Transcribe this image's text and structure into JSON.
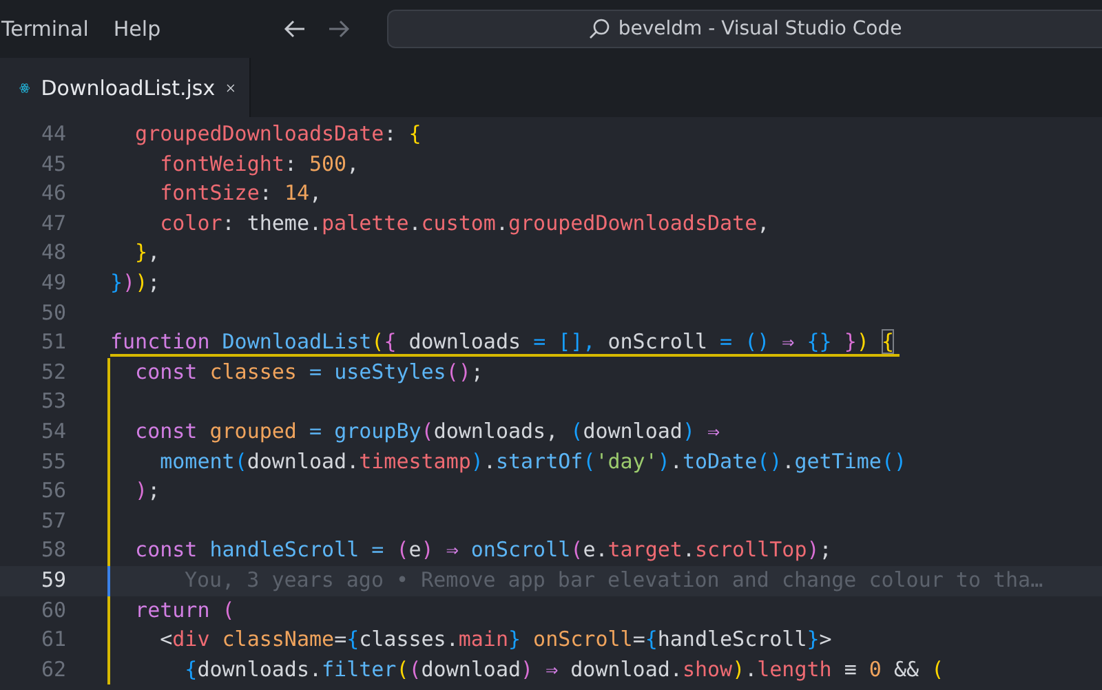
{
  "menu": [
    "Terminal",
    "Help"
  ],
  "command_center": {
    "text": "beveldm - Visual Studio Code"
  },
  "tabs": [
    {
      "label": "DownloadList.jsx",
      "selected": true
    }
  ],
  "editor": {
    "lines": [
      {
        "number": "44",
        "in_scope": false,
        "tokens": [
          {
            "text": "  groupedDownloadsDate",
            "kind": "prop"
          },
          {
            "text": ": ",
            "kind": "plain"
          },
          {
            "text": "{",
            "kind": "b1"
          }
        ]
      },
      {
        "number": "45",
        "in_scope": false,
        "tokens": [
          {
            "text": "    fontWeight",
            "kind": "prop"
          },
          {
            "text": ": ",
            "kind": "plain"
          },
          {
            "text": "500",
            "kind": "num"
          },
          {
            "text": ",",
            "kind": "plain"
          }
        ]
      },
      {
        "number": "46",
        "in_scope": false,
        "tokens": [
          {
            "text": "    fontSize",
            "kind": "prop"
          },
          {
            "text": ": ",
            "kind": "plain"
          },
          {
            "text": "14",
            "kind": "num"
          },
          {
            "text": ",",
            "kind": "plain"
          }
        ]
      },
      {
        "number": "47",
        "in_scope": false,
        "tokens": [
          {
            "text": "    color",
            "kind": "prop"
          },
          {
            "text": ": theme.",
            "kind": "plain"
          },
          {
            "text": "palette",
            "kind": "prop"
          },
          {
            "text": ".",
            "kind": "plain"
          },
          {
            "text": "custom",
            "kind": "prop"
          },
          {
            "text": ".",
            "kind": "plain"
          },
          {
            "text": "groupedDownloadsDate",
            "kind": "prop"
          },
          {
            "text": ",",
            "kind": "plain"
          }
        ]
      },
      {
        "number": "48",
        "in_scope": false,
        "tokens": [
          {
            "text": "  }",
            "kind": "b1"
          },
          {
            "text": ",",
            "kind": "plain"
          }
        ]
      },
      {
        "number": "49",
        "in_scope": false,
        "tokens": [
          {
            "text": "}",
            "kind": "b3"
          },
          {
            "text": ")",
            "kind": "b2"
          },
          {
            "text": ")",
            "kind": "b1"
          },
          {
            "text": ";",
            "kind": "plain"
          }
        ]
      },
      {
        "number": "50",
        "in_scope": false
      },
      {
        "number": "51",
        "in_scope": false,
        "scope_open": true,
        "tokens": [
          {
            "text": "function ",
            "kind": "kw"
          },
          {
            "text": "DownloadList",
            "kind": "fn"
          },
          {
            "text": "(",
            "kind": "b1"
          },
          {
            "text": "{",
            "kind": "b2"
          },
          {
            "text": " downloads ",
            "kind": "plain"
          },
          {
            "text": "= [], ",
            "kind": "b3"
          },
          {
            "text": "onScroll ",
            "kind": "plain"
          },
          {
            "text": "= ()",
            "kind": "b3"
          },
          {
            "text": " ⇒ ",
            "kind": "kw"
          },
          {
            "text": "{}",
            "kind": "b3"
          },
          {
            "text": " }",
            "kind": "b2"
          },
          {
            "text": ") ",
            "kind": "b1"
          },
          {
            "text": "{",
            "kind": "match"
          }
        ]
      },
      {
        "number": "52",
        "in_scope": true,
        "tokens": [
          {
            "text": "  const",
            "kind": "kw"
          },
          {
            "text": " classes",
            "kind": "var"
          },
          {
            "text": " = ",
            "kind": "op"
          },
          {
            "text": "useStyles",
            "kind": "fn"
          },
          {
            "text": "()",
            "kind": "b2"
          },
          {
            "text": ";",
            "kind": "plain"
          }
        ]
      },
      {
        "number": "53",
        "in_scope": true
      },
      {
        "number": "54",
        "in_scope": true,
        "tokens": [
          {
            "text": "  const",
            "kind": "kw"
          },
          {
            "text": " grouped",
            "kind": "var"
          },
          {
            "text": " = ",
            "kind": "op"
          },
          {
            "text": "groupBy",
            "kind": "fn"
          },
          {
            "text": "(",
            "kind": "b2"
          },
          {
            "text": "downloads, ",
            "kind": "plain"
          },
          {
            "text": "(",
            "kind": "b3"
          },
          {
            "text": "download",
            "kind": "plain"
          },
          {
            "text": ")",
            "kind": "b3"
          },
          {
            "text": " ⇒",
            "kind": "kw"
          }
        ]
      },
      {
        "number": "55",
        "in_scope": true,
        "tokens": [
          {
            "text": "    moment",
            "kind": "fn"
          },
          {
            "text": "(",
            "kind": "b3"
          },
          {
            "text": "download.",
            "kind": "plain"
          },
          {
            "text": "timestamp",
            "kind": "prop"
          },
          {
            "text": ")",
            "kind": "b3"
          },
          {
            "text": ".",
            "kind": "plain"
          },
          {
            "text": "startOf",
            "kind": "fn"
          },
          {
            "text": "(",
            "kind": "b3"
          },
          {
            "text": "'day'",
            "kind": "str"
          },
          {
            "text": ")",
            "kind": "b3"
          },
          {
            "text": ".",
            "kind": "plain"
          },
          {
            "text": "toDate",
            "kind": "fn"
          },
          {
            "text": "()",
            "kind": "b3"
          },
          {
            "text": ".",
            "kind": "plain"
          },
          {
            "text": "getTime",
            "kind": "fn"
          },
          {
            "text": "()",
            "kind": "b3"
          }
        ]
      },
      {
        "number": "56",
        "in_scope": true,
        "tokens": [
          {
            "text": "  )",
            "kind": "b2"
          },
          {
            "text": ";",
            "kind": "plain"
          }
        ]
      },
      {
        "number": "57",
        "in_scope": true
      },
      {
        "number": "58",
        "in_scope": true,
        "tokens": [
          {
            "text": "  const",
            "kind": "kw"
          },
          {
            "text": " handleScroll",
            "kind": "fn"
          },
          {
            "text": " = ",
            "kind": "op"
          },
          {
            "text": "(",
            "kind": "b2"
          },
          {
            "text": "e",
            "kind": "plain"
          },
          {
            "text": ")",
            "kind": "b2"
          },
          {
            "text": " ⇒ ",
            "kind": "kw"
          },
          {
            "text": "onScroll",
            "kind": "fn"
          },
          {
            "text": "(",
            "kind": "b2"
          },
          {
            "text": "e.",
            "kind": "plain"
          },
          {
            "text": "target",
            "kind": "prop"
          },
          {
            "text": ".",
            "kind": "plain"
          },
          {
            "text": "scrollTop",
            "kind": "prop"
          },
          {
            "text": ")",
            "kind": "b2"
          },
          {
            "text": ";",
            "kind": "plain"
          }
        ]
      },
      {
        "number": "59",
        "in_scope": true,
        "current": true,
        "blame": "You, 3 years ago • Remove app bar elevation and change colour to tha…"
      },
      {
        "number": "60",
        "in_scope": true,
        "tokens": [
          {
            "text": "  return",
            "kind": "kw"
          },
          {
            "text": " (",
            "kind": "b2"
          }
        ]
      },
      {
        "number": "61",
        "in_scope": true,
        "tokens": [
          {
            "text": "    <",
            "kind": "plain"
          },
          {
            "text": "div",
            "kind": "prop"
          },
          {
            "text": " className",
            "kind": "var"
          },
          {
            "text": "=",
            "kind": "plain"
          },
          {
            "text": "{",
            "kind": "b3"
          },
          {
            "text": "classes.",
            "kind": "plain"
          },
          {
            "text": "main",
            "kind": "prop"
          },
          {
            "text": "}",
            "kind": "b3"
          },
          {
            "text": " onScroll",
            "kind": "var"
          },
          {
            "text": "=",
            "kind": "plain"
          },
          {
            "text": "{",
            "kind": "b3"
          },
          {
            "text": "handleScroll",
            "kind": "plain"
          },
          {
            "text": "}",
            "kind": "b3"
          },
          {
            "text": ">",
            "kind": "plain"
          }
        ]
      },
      {
        "number": "62",
        "in_scope": true,
        "tokens": [
          {
            "text": "      {",
            "kind": "b3"
          },
          {
            "text": "downloads.",
            "kind": "plain"
          },
          {
            "text": "filter",
            "kind": "fn"
          },
          {
            "text": "(",
            "kind": "b1"
          },
          {
            "text": "(",
            "kind": "b2"
          },
          {
            "text": "download",
            "kind": "plain"
          },
          {
            "text": ")",
            "kind": "b2"
          },
          {
            "text": " ⇒ ",
            "kind": "kw"
          },
          {
            "text": "download.",
            "kind": "plain"
          },
          {
            "text": "show",
            "kind": "prop"
          },
          {
            "text": ")",
            "kind": "b1"
          },
          {
            "text": ".",
            "kind": "plain"
          },
          {
            "text": "length",
            "kind": "prop"
          },
          {
            "text": " ≡ ",
            "kind": "plain"
          },
          {
            "text": "0",
            "kind": "num"
          },
          {
            "text": " && ",
            "kind": "plain"
          },
          {
            "text": "(",
            "kind": "b1"
          }
        ]
      }
    ]
  }
}
